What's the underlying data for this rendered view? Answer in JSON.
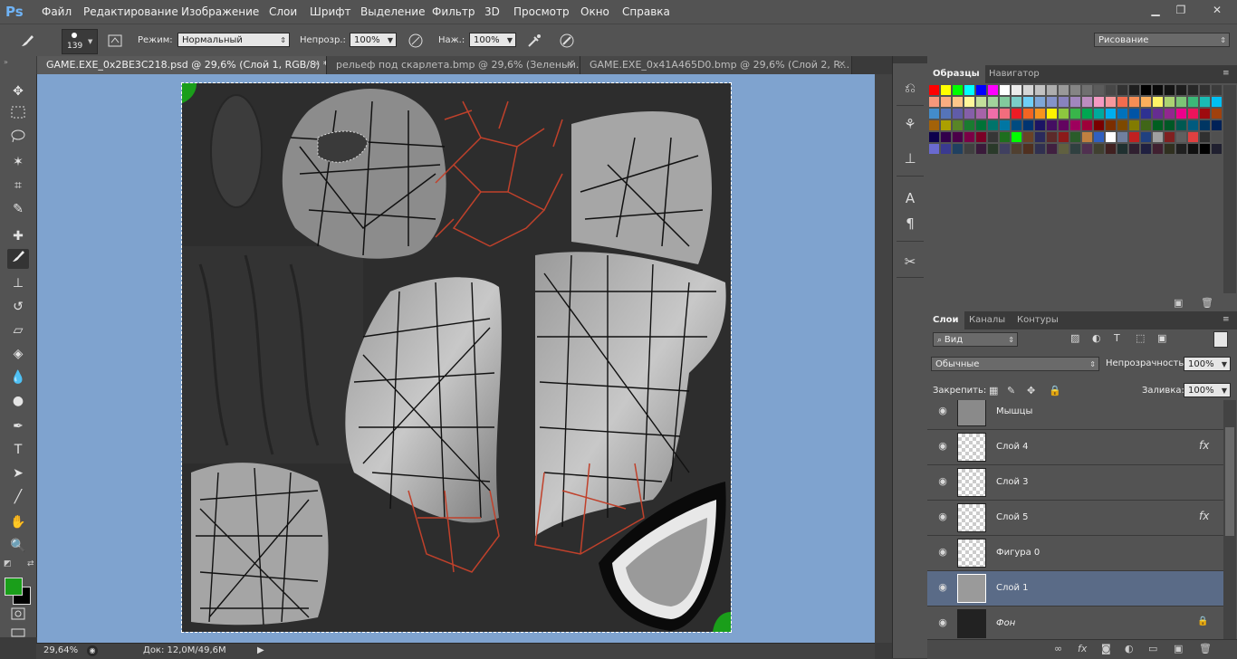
{
  "app": {
    "logo": "Ps"
  },
  "menu": [
    "Файл",
    "Редактирование",
    "Изображение",
    "Слои",
    "Шрифт",
    "Выделение",
    "Фильтр",
    "3D",
    "Просмотр",
    "Окно",
    "Справка"
  ],
  "options": {
    "brush_size": "139",
    "mode_label": "Режим:",
    "mode_value": "Нормальный",
    "opacity_label": "Непрозр.:",
    "opacity_value": "100%",
    "pressure_label": "Наж.:",
    "pressure_value": "100%",
    "workspace_value": "Рисование"
  },
  "tabs": [
    {
      "label": "GAME.EXE_0x2BE3C218.psd @ 29,6% (Слой 1, RGB/8) *",
      "active": true
    },
    {
      "label": "рельеф под скарлета.bmp @ 29,6% (Зеленый...",
      "active": false
    },
    {
      "label": "GAME.EXE_0x41A465D0.bmp @ 29,6% (Слой 2, R...",
      "active": false
    }
  ],
  "status": {
    "zoom": "29,64%",
    "doc": "Док: 12,0M/49,6M"
  },
  "swatches_panel": {
    "tabs": [
      "Образцы",
      "Навигатор"
    ],
    "colors": [
      "#ff0000",
      "#ffff00",
      "#00ff00",
      "#00ffff",
      "#0000ff",
      "#ff00ff",
      "#ffffff",
      "#ebebeb",
      "#d6d6d6",
      "#c2c2c2",
      "#adadad",
      "#999999",
      "#858585",
      "#707070",
      "#5c5c5c",
      "#474747",
      "#333333",
      "#1f1f1f",
      "#000000",
      "#0a0a0a",
      "#141414",
      "#1e1e1e",
      "#282828",
      "#323232",
      "#3c3c3c",
      "#f7977a",
      "#f9ad81",
      "#fdc68a",
      "#fff79a",
      "#c4df9b",
      "#a2d39c",
      "#82ca9d",
      "#7bcdc8",
      "#6ecff6",
      "#7ea7d8",
      "#8493ca",
      "#8882be",
      "#a187be",
      "#bc8dbf",
      "#f49ac2",
      "#f6989d",
      "#f26c4f",
      "#f68e55",
      "#fbaf5c",
      "#fff467",
      "#acd372",
      "#7cc576",
      "#3bb878",
      "#1abbb4",
      "#00bff3",
      "#438ccb",
      "#5574b9",
      "#605ca8",
      "#855fa8",
      "#a763a8",
      "#f06ea9",
      "#f26d7d",
      "#ed1c24",
      "#f26522",
      "#f7941d",
      "#fff200",
      "#8dc73f",
      "#39b54a",
      "#00a651",
      "#00a99d",
      "#00aeef",
      "#0072bc",
      "#0054a6",
      "#2e3192",
      "#662d91",
      "#92278f",
      "#ec008c",
      "#ed145b",
      "#9e0b0f",
      "#a0410d",
      "#a36209",
      "#aba000",
      "#598527",
      "#1a7b30",
      "#007236",
      "#00746b",
      "#0076a3",
      "#004b80",
      "#003471",
      "#1b1464",
      "#440e62",
      "#630460",
      "#9e005d",
      "#9e0039",
      "#790000",
      "#7b2e00",
      "#7d4900",
      "#827b00",
      "#406618",
      "#005e20",
      "#005826",
      "#005952",
      "#005b7f",
      "#003663",
      "#002157",
      "#0d004c",
      "#32004b",
      "#4b0049",
      "#7b0046",
      "#7a0026",
      "#363636",
      "#1e6e1e",
      "#00ff00",
      "#6b4226",
      "#2a2a5c",
      "#5c2a2a",
      "#8c1a1a",
      "#2a5c2a",
      "#c08040",
      "#3060c0",
      "#ffffff",
      "#7080a0",
      "#c02020",
      "#204080",
      "#a0a0a0",
      "#802020",
      "#606060",
      "#e04040",
      "#303030",
      "#505050",
      "#6a6ad0",
      "#3a3a90",
      "#204060",
      "#404040",
      "#3a1a3a",
      "#2a3a2a",
      "#404060",
      "#504030",
      "#503020",
      "#303050",
      "#402040",
      "#606040",
      "#304040",
      "#503050",
      "#404030",
      "#402020",
      "#203030",
      "#302030",
      "#202040",
      "#402030",
      "#303020",
      "#202020",
      "#101010",
      "#000000",
      "#202030"
    ]
  },
  "layers_panel": {
    "tabs": [
      "Слои",
      "Каналы",
      "Контуры"
    ],
    "filter_value": "Вид",
    "blend_value": "Обычные",
    "opacity_label": "Непрозрачность:",
    "opacity_value": "100%",
    "lock_label": "Закрепить:",
    "fill_label": "Заливка:",
    "fill_value": "100%",
    "layers": [
      {
        "name": "Мышцы",
        "fx": "",
        "selected": false
      },
      {
        "name": "Слой 4",
        "fx": "fx",
        "selected": false
      },
      {
        "name": "Слой 3",
        "fx": "",
        "selected": false
      },
      {
        "name": "Слой 5",
        "fx": "fx",
        "selected": false
      },
      {
        "name": "Фигура 0",
        "fx": "",
        "selected": false
      },
      {
        "name": "Слой 1",
        "fx": "",
        "selected": true
      },
      {
        "name": "Фон",
        "fx": "",
        "selected": false
      }
    ]
  },
  "colors": {
    "foreground": "#1a9e1a",
    "background": "#000000",
    "canvas_bg": "#7fa3cf",
    "selected_layer": "#5a6b87"
  }
}
